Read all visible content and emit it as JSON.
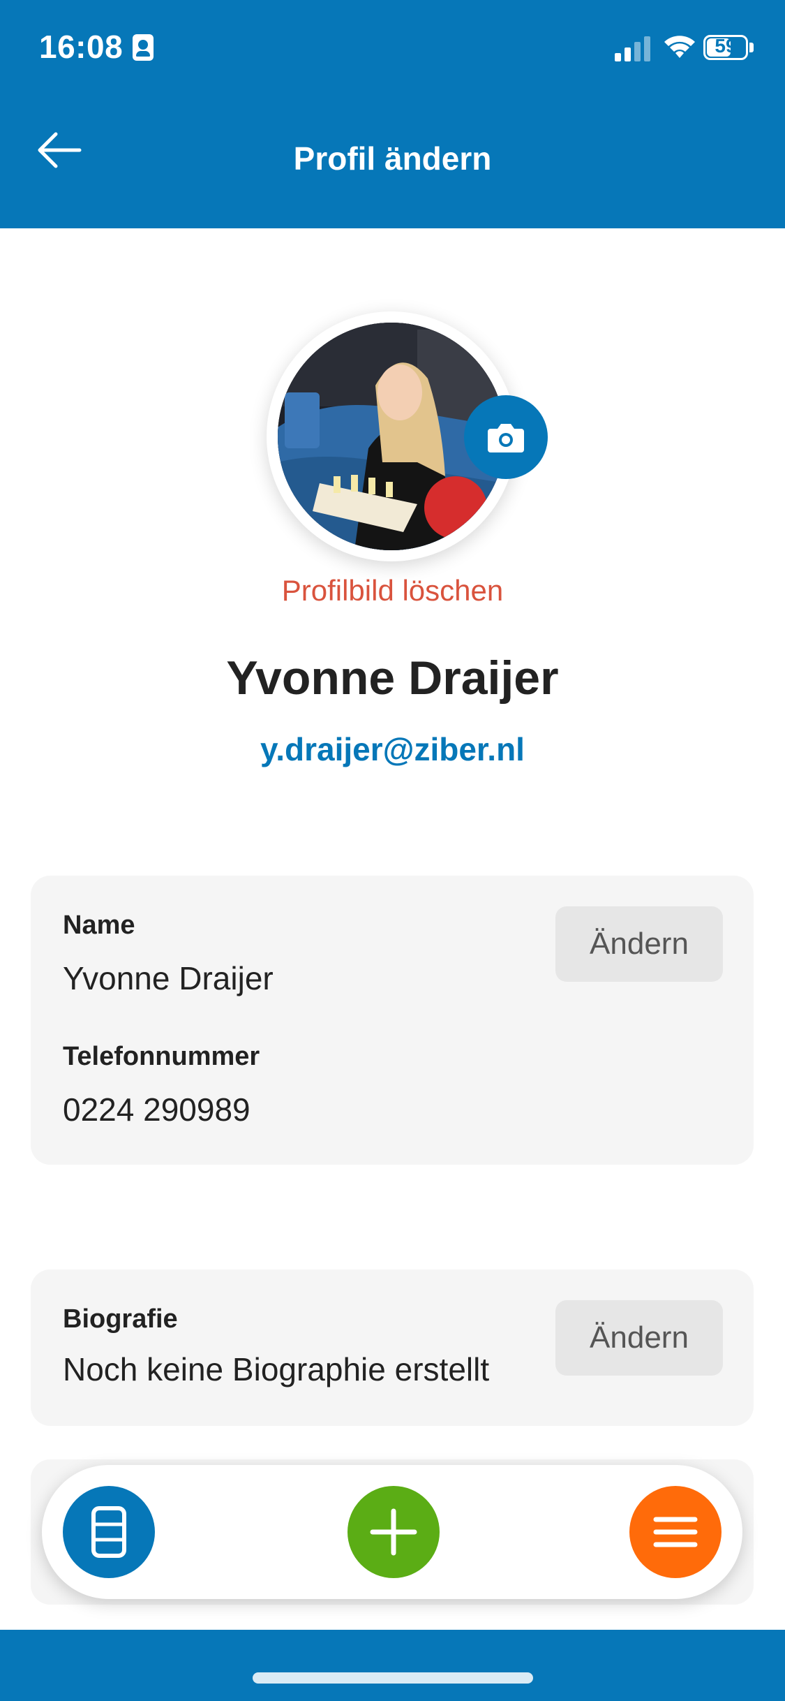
{
  "status_bar": {
    "time": "16:08",
    "battery_level": "59",
    "icons": [
      "contact-card-icon",
      "cellular-signal-icon",
      "wifi-icon",
      "battery-icon"
    ]
  },
  "header": {
    "title": "Profil ändern",
    "back_icon": "arrow-left-icon"
  },
  "profile": {
    "photo_description": "profile-photo",
    "camera_icon": "camera-icon",
    "delete_photo_label": "Profilbild löschen",
    "name": "Yvonne Draijer",
    "email": "y.draijer@ziber.nl"
  },
  "details_card": {
    "name_label": "Name",
    "name_value": "Yvonne Draijer",
    "phone_label": "Telefonnummer",
    "phone_value": "0224 290989",
    "edit_label": "Ändern"
  },
  "bio_card": {
    "label": "Biografie",
    "value": "Noch keine Biographie erstellt",
    "edit_label": "Ändern"
  },
  "bottom_nav": {
    "left_icon": "list-icon",
    "center_icon": "plus-icon",
    "right_icon": "menu-icon"
  },
  "colors": {
    "primary": "#0677b8",
    "danger": "#d9533d",
    "green": "#5bad15",
    "orange": "#ff6b0a"
  }
}
